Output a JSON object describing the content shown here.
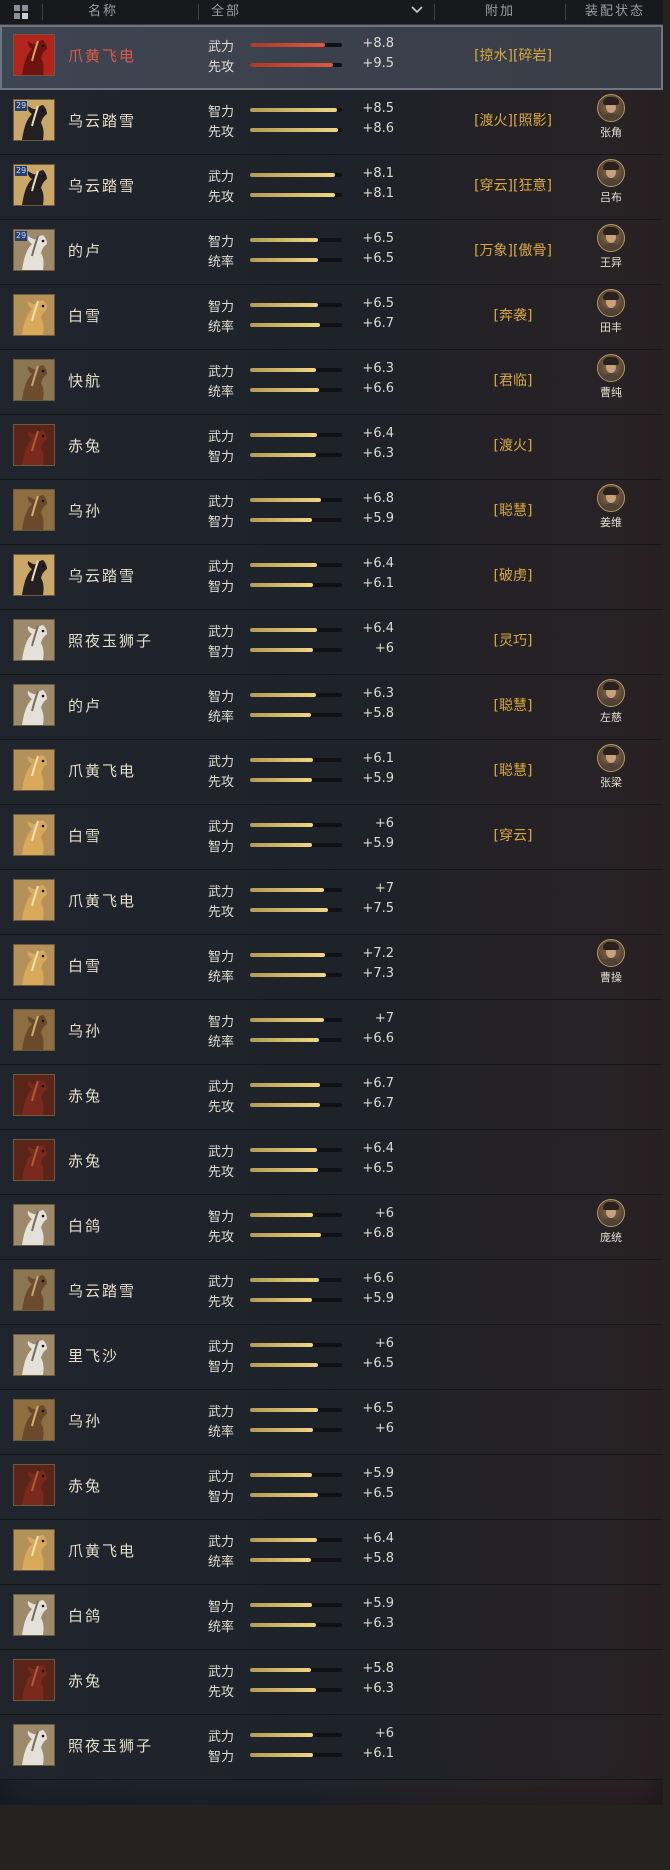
{
  "header": {
    "name": "名称",
    "filter": "全部",
    "extra": "附加",
    "status": "装配状态"
  },
  "rows": [
    {
      "name": "爪黄飞电",
      "selected": true,
      "tier": "",
      "horse": "chestnut",
      "stats": [
        {
          "label": "武力",
          "value": "+8.8",
          "fill": 0.82
        },
        {
          "label": "先攻",
          "value": "+9.5",
          "fill": 0.9
        }
      ],
      "extras": "[掠水][碎岩]",
      "general": ""
    },
    {
      "name": "乌云踏雪",
      "selected": false,
      "tier": "29",
      "horse": "black",
      "stats": [
        {
          "label": "智力",
          "value": "+8.5",
          "fill": 0.95
        },
        {
          "label": "先攻",
          "value": "+8.6",
          "fill": 0.96
        }
      ],
      "extras": "[渡火][照影]",
      "general": "张角"
    },
    {
      "name": "乌云踏雪",
      "selected": false,
      "tier": "29",
      "horse": "black",
      "stats": [
        {
          "label": "武力",
          "value": "+8.1",
          "fill": 0.92
        },
        {
          "label": "先攻",
          "value": "+8.1",
          "fill": 0.92
        }
      ],
      "extras": "[穿云][狂意]",
      "general": "吕布"
    },
    {
      "name": "的卢",
      "selected": false,
      "tier": "29",
      "horse": "white",
      "stats": [
        {
          "label": "智力",
          "value": "+6.5",
          "fill": 0.74
        },
        {
          "label": "统率",
          "value": "+6.5",
          "fill": 0.74
        }
      ],
      "extras": "[万象][傲骨]",
      "general": "王异"
    },
    {
      "name": "白雪",
      "selected": false,
      "tier": "",
      "horse": "palomino",
      "stats": [
        {
          "label": "智力",
          "value": "+6.5",
          "fill": 0.74
        },
        {
          "label": "统率",
          "value": "+6.7",
          "fill": 0.76
        }
      ],
      "extras": "[奔袭]",
      "general": "田丰"
    },
    {
      "name": "快航",
      "selected": false,
      "tier": "",
      "horse": "dun",
      "stats": [
        {
          "label": "武力",
          "value": "+6.3",
          "fill": 0.72
        },
        {
          "label": "统率",
          "value": "+6.6",
          "fill": 0.75
        }
      ],
      "extras": "[君临]",
      "general": "曹纯"
    },
    {
      "name": "赤兔",
      "selected": false,
      "tier": "",
      "horse": "red",
      "stats": [
        {
          "label": "武力",
          "value": "+6.4",
          "fill": 0.73
        },
        {
          "label": "智力",
          "value": "+6.3",
          "fill": 0.72
        }
      ],
      "extras": "[渡火]",
      "general": ""
    },
    {
      "name": "乌孙",
      "selected": false,
      "tier": "",
      "horse": "armored",
      "stats": [
        {
          "label": "武力",
          "value": "+6.8",
          "fill": 0.77
        },
        {
          "label": "智力",
          "value": "+5.9",
          "fill": 0.67
        }
      ],
      "extras": "[聪慧]",
      "general": "姜维"
    },
    {
      "name": "乌云踏雪",
      "selected": false,
      "tier": "",
      "horse": "black",
      "stats": [
        {
          "label": "武力",
          "value": "+6.4",
          "fill": 0.73
        },
        {
          "label": "智力",
          "value": "+6.1",
          "fill": 0.69
        }
      ],
      "extras": "[破虏]",
      "general": ""
    },
    {
      "name": "照夜玉狮子",
      "selected": false,
      "tier": "",
      "horse": "white",
      "stats": [
        {
          "label": "武力",
          "value": "+6.4",
          "fill": 0.73
        },
        {
          "label": "智力",
          "value": "+6",
          "fill": 0.68
        }
      ],
      "extras": "[灵巧]",
      "general": ""
    },
    {
      "name": "的卢",
      "selected": false,
      "tier": "",
      "horse": "white",
      "stats": [
        {
          "label": "智力",
          "value": "+6.3",
          "fill": 0.72
        },
        {
          "label": "统率",
          "value": "+5.8",
          "fill": 0.66
        }
      ],
      "extras": "[聪慧]",
      "general": "左慈"
    },
    {
      "name": "爪黄飞电",
      "selected": false,
      "tier": "",
      "horse": "palomino",
      "stats": [
        {
          "label": "武力",
          "value": "+6.1",
          "fill": 0.69
        },
        {
          "label": "先攻",
          "value": "+5.9",
          "fill": 0.67
        }
      ],
      "extras": "[聪慧]",
      "general": "张梁"
    },
    {
      "name": "白雪",
      "selected": false,
      "tier": "",
      "horse": "palomino",
      "stats": [
        {
          "label": "武力",
          "value": "+6",
          "fill": 0.68
        },
        {
          "label": "智力",
          "value": "+5.9",
          "fill": 0.67
        }
      ],
      "extras": "[穿云]",
      "general": ""
    },
    {
      "name": "爪黄飞电",
      "selected": false,
      "tier": "",
      "horse": "palomino",
      "stats": [
        {
          "label": "武力",
          "value": "+7",
          "fill": 0.8
        },
        {
          "label": "先攻",
          "value": "+7.5",
          "fill": 0.85
        }
      ],
      "extras": "",
      "general": ""
    },
    {
      "name": "白雪",
      "selected": false,
      "tier": "",
      "horse": "palomino",
      "stats": [
        {
          "label": "智力",
          "value": "+7.2",
          "fill": 0.82
        },
        {
          "label": "统率",
          "value": "+7.3",
          "fill": 0.83
        }
      ],
      "extras": "",
      "general": "曹操"
    },
    {
      "name": "乌孙",
      "selected": false,
      "tier": "",
      "horse": "armored",
      "stats": [
        {
          "label": "智力",
          "value": "+7",
          "fill": 0.8
        },
        {
          "label": "统率",
          "value": "+6.6",
          "fill": 0.75
        }
      ],
      "extras": "",
      "general": ""
    },
    {
      "name": "赤兔",
      "selected": false,
      "tier": "",
      "horse": "red",
      "stats": [
        {
          "label": "武力",
          "value": "+6.7",
          "fill": 0.76
        },
        {
          "label": "先攻",
          "value": "+6.7",
          "fill": 0.76
        }
      ],
      "extras": "",
      "general": ""
    },
    {
      "name": "赤兔",
      "selected": false,
      "tier": "",
      "horse": "red",
      "stats": [
        {
          "label": "武力",
          "value": "+6.4",
          "fill": 0.73
        },
        {
          "label": "先攻",
          "value": "+6.5",
          "fill": 0.74
        }
      ],
      "extras": "",
      "general": ""
    },
    {
      "name": "白鸽",
      "selected": false,
      "tier": "",
      "horse": "white",
      "stats": [
        {
          "label": "智力",
          "value": "+6",
          "fill": 0.68
        },
        {
          "label": "先攻",
          "value": "+6.8",
          "fill": 0.77
        }
      ],
      "extras": "",
      "general": "庞统"
    },
    {
      "name": "乌云踏雪",
      "selected": false,
      "tier": "",
      "horse": "dun",
      "stats": [
        {
          "label": "武力",
          "value": "+6.6",
          "fill": 0.75
        },
        {
          "label": "先攻",
          "value": "+5.9",
          "fill": 0.67
        }
      ],
      "extras": "",
      "general": ""
    },
    {
      "name": "里飞沙",
      "selected": false,
      "tier": "",
      "horse": "white",
      "stats": [
        {
          "label": "武力",
          "value": "+6",
          "fill": 0.68
        },
        {
          "label": "智力",
          "value": "+6.5",
          "fill": 0.74
        }
      ],
      "extras": "",
      "general": ""
    },
    {
      "name": "乌孙",
      "selected": false,
      "tier": "",
      "horse": "armored",
      "stats": [
        {
          "label": "武力",
          "value": "+6.5",
          "fill": 0.74
        },
        {
          "label": "统率",
          "value": "+6",
          "fill": 0.68
        }
      ],
      "extras": "",
      "general": ""
    },
    {
      "name": "赤兔",
      "selected": false,
      "tier": "",
      "horse": "red",
      "stats": [
        {
          "label": "武力",
          "value": "+5.9",
          "fill": 0.67
        },
        {
          "label": "智力",
          "value": "+6.5",
          "fill": 0.74
        }
      ],
      "extras": "",
      "general": ""
    },
    {
      "name": "爪黄飞电",
      "selected": false,
      "tier": "",
      "horse": "palomino",
      "stats": [
        {
          "label": "武力",
          "value": "+6.4",
          "fill": 0.73
        },
        {
          "label": "统率",
          "value": "+5.8",
          "fill": 0.66
        }
      ],
      "extras": "",
      "general": ""
    },
    {
      "name": "白鸽",
      "selected": false,
      "tier": "",
      "horse": "white",
      "stats": [
        {
          "label": "智力",
          "value": "+5.9",
          "fill": 0.67
        },
        {
          "label": "统率",
          "value": "+6.3",
          "fill": 0.72
        }
      ],
      "extras": "",
      "general": ""
    },
    {
      "name": "赤兔",
      "selected": false,
      "tier": "",
      "horse": "red",
      "stats": [
        {
          "label": "武力",
          "value": "+5.8",
          "fill": 0.66
        },
        {
          "label": "先攻",
          "value": "+6.3",
          "fill": 0.72
        }
      ],
      "extras": "",
      "general": ""
    },
    {
      "name": "照夜玉狮子",
      "selected": false,
      "tier": "",
      "horse": "white",
      "stats": [
        {
          "label": "武力",
          "value": "+6",
          "fill": 0.68
        },
        {
          "label": "智力",
          "value": "+6.1",
          "fill": 0.69
        }
      ],
      "extras": "",
      "general": ""
    }
  ]
}
